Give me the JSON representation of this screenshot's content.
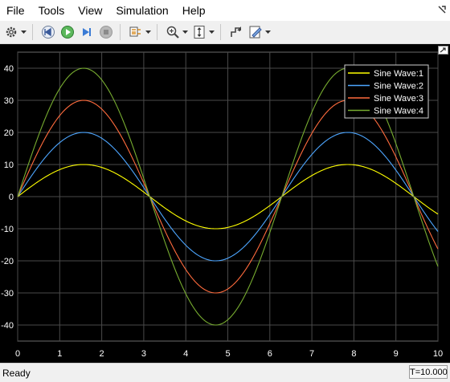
{
  "menu": {
    "file": "File",
    "tools": "Tools",
    "view": "View",
    "simulation": "Simulation",
    "help": "Help"
  },
  "toolbar": {
    "icons": [
      "gear-icon",
      "step-back-icon",
      "run-icon",
      "step-forward-icon",
      "stop-icon",
      "signal-selector-icon",
      "zoom-icon",
      "autoscale-icon",
      "highlight-block-icon",
      "style-icon"
    ]
  },
  "status": {
    "text": "Ready",
    "time": "T=10.000"
  },
  "colors": {
    "background": "#000000",
    "grid": "#4a4a4a",
    "axis_text": "#ffffff",
    "series": [
      "#ffff00",
      "#0072bd",
      "#d95319",
      "#77ac30"
    ]
  },
  "chart_data": {
    "type": "line",
    "title": "",
    "xlabel": "",
    "ylabel": "",
    "xlim": [
      0,
      10
    ],
    "ylim": [
      -45,
      45
    ],
    "xticks": [
      0,
      1,
      2,
      3,
      4,
      5,
      6,
      7,
      8,
      9,
      10
    ],
    "yticks": [
      -40,
      -30,
      -20,
      -10,
      0,
      10,
      20,
      30,
      40
    ],
    "grid": true,
    "legend_position": "top-right",
    "series": [
      {
        "name": "Sine Wave:1",
        "amplitude": 10,
        "color": "#ffff00"
      },
      {
        "name": "Sine Wave:2",
        "amplitude": 20,
        "color": "#4da6ff"
      },
      {
        "name": "Sine Wave:3",
        "amplitude": 30,
        "color": "#ff6b3d"
      },
      {
        "name": "Sine Wave:4",
        "amplitude": 40,
        "color": "#77ac30"
      }
    ],
    "function": "amplitude*sin(x)"
  }
}
